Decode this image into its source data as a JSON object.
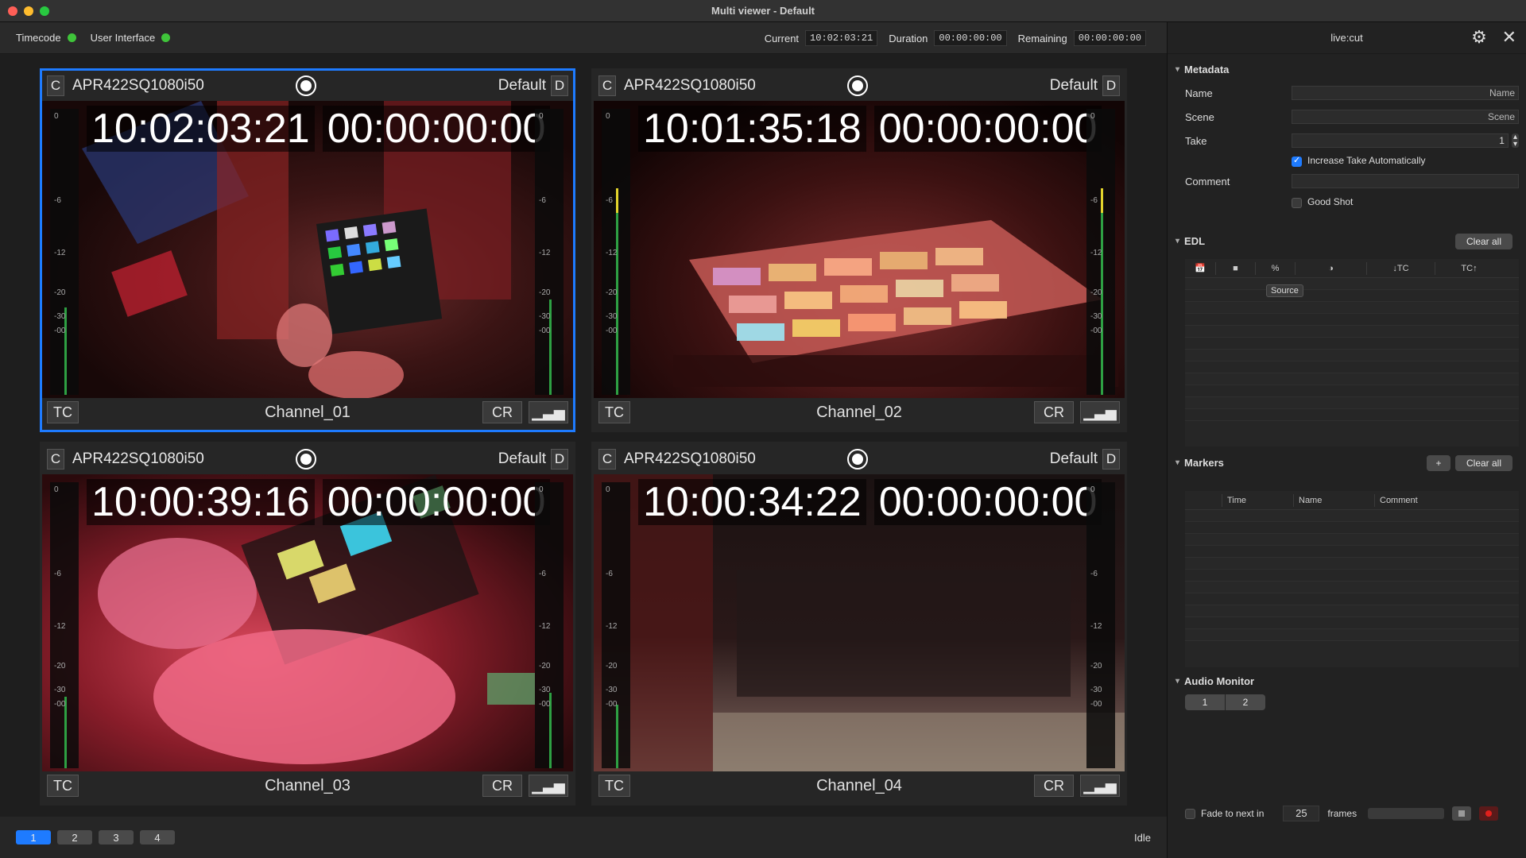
{
  "window": {
    "title": "Multi viewer - Default"
  },
  "status": {
    "timecode_label": "Timecode",
    "ui_label": "User Interface",
    "current_label": "Current",
    "current_value": "10:02:03:21",
    "duration_label": "Duration",
    "duration_value": "00:00:00:00",
    "remaining_label": "Remaining",
    "remaining_value": "00:00:00:00"
  },
  "viewers": [
    {
      "c": "C",
      "format": "APR422SQ1080i50",
      "preset": "Default",
      "d": "D",
      "tc": "10:02:03:21",
      "dur": "00:00:00:00",
      "tc_btn": "TC",
      "channel": "Channel_01",
      "cr": "CR",
      "meter_ticks": [
        "0",
        "-6",
        "-12",
        "-20",
        "-30",
        "-00"
      ]
    },
    {
      "c": "C",
      "format": "APR422SQ1080i50",
      "preset": "Default",
      "d": "D",
      "tc": "10:01:35:18",
      "dur": "00:00:00:00",
      "tc_btn": "TC",
      "channel": "Channel_02",
      "cr": "CR",
      "meter_ticks": [
        "0",
        "-6",
        "-12",
        "-20",
        "-30",
        "-00"
      ]
    },
    {
      "c": "C",
      "format": "APR422SQ1080i50",
      "preset": "Default",
      "d": "D",
      "tc": "10:00:39:16",
      "dur": "00:00:00:00",
      "tc_btn": "TC",
      "channel": "Channel_03",
      "cr": "CR",
      "meter_ticks": [
        "0",
        "-6",
        "-12",
        "-20",
        "-30",
        "-00"
      ]
    },
    {
      "c": "C",
      "format": "APR422SQ1080i50",
      "preset": "Default",
      "d": "D",
      "tc": "10:00:34:22",
      "dur": "00:00:00:00",
      "tc_btn": "TC",
      "channel": "Channel_04",
      "cr": "CR",
      "meter_ticks": [
        "0",
        "-6",
        "-12",
        "-20",
        "-30",
        "-00"
      ]
    }
  ],
  "pages": [
    "1",
    "2",
    "3",
    "4"
  ],
  "idle_label": "Idle",
  "panel": {
    "title": "live:cut",
    "metadata_title": "Metadata",
    "name_label": "Name",
    "name_placeholder": "Name",
    "scene_label": "Scene",
    "scene_placeholder": "Scene",
    "take_label": "Take",
    "take_value": "1",
    "increase_take": "Increase Take Automatically",
    "comment_label": "Comment",
    "good_shot": "Good Shot",
    "edl_title": "EDL",
    "edl_clear": "Clear all",
    "edl_cols": [
      "📅",
      "■",
      "%",
      "◑",
      "↓TC",
      "TC↑"
    ],
    "edl_tooltip": "Source",
    "markers_title": "Markers",
    "markers_add": "+",
    "markers_clear": "Clear all",
    "marker_cols": [
      "Time",
      "Name",
      "Comment"
    ],
    "audio_title": "Audio Monitor",
    "audio_channels": [
      "1",
      "2"
    ],
    "fade_label": "Fade to next in",
    "fade_value": "25",
    "frames_label": "frames"
  },
  "colors": {
    "accent": "#1e7bff",
    "status_green": "#3fc43a",
    "record_red": "#e0201c"
  }
}
